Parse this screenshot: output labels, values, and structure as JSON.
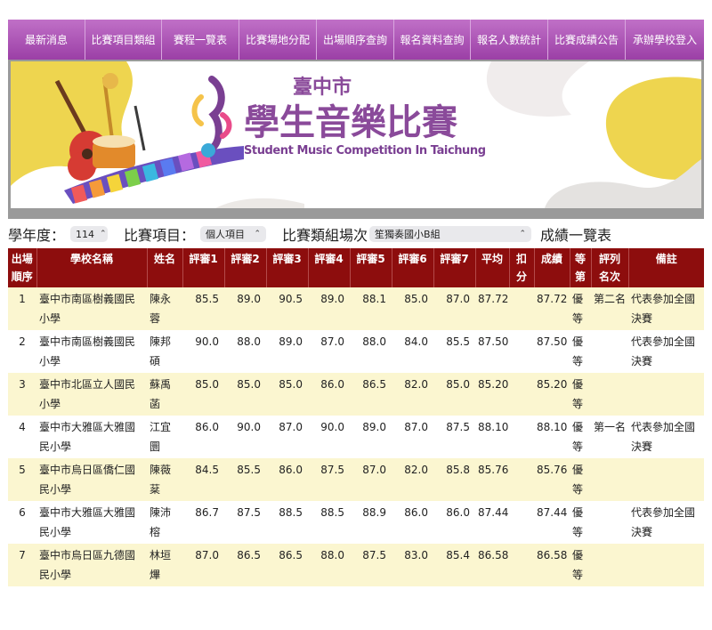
{
  "nav": [
    {
      "label": "最新消息"
    },
    {
      "label": "比賽項目類組"
    },
    {
      "label": "賽程一覽表"
    },
    {
      "label": "比賽場地分配"
    },
    {
      "label": "出場順序查詢"
    },
    {
      "label": "報名資料查詢"
    },
    {
      "label": "報名人數統計"
    },
    {
      "label": "比賽成績公告"
    },
    {
      "label": "承辦學校登入"
    }
  ],
  "banner": {
    "city": "臺中市",
    "title": "學生音樂比賽",
    "subtitle": "Student Music Competition In Taichung",
    "colors": {
      "yellow": "#eed54f",
      "purple": "#8a4a9a",
      "gray": "#e4e2e0"
    }
  },
  "filters": {
    "year_label": "學年度：",
    "year_value": "114",
    "item_label": "比賽項目：",
    "item_value": "個人項目",
    "group_label": "比賽類組場次",
    "group_value": "笙獨奏國小B組",
    "result_label": "成績一覽表"
  },
  "table": {
    "headers": [
      "出場順序",
      "學校名稱",
      "姓名",
      "評審1",
      "評審2",
      "評審3",
      "評審4",
      "評審5",
      "評審6",
      "評審7",
      "平均",
      "扣分",
      "成績",
      "等第",
      "評列名次",
      "備註"
    ],
    "rows": [
      [
        "1",
        "臺中市南區樹義國民小學",
        "陳永蓉",
        "85.5",
        "89.0",
        "90.5",
        "89.0",
        "88.1",
        "85.0",
        "87.0",
        "87.72",
        "",
        "87.72",
        "優等",
        "第二名",
        "代表參加全國決賽"
      ],
      [
        "2",
        "臺中市南區樹義國民小學",
        "陳邦碩",
        "90.0",
        "88.0",
        "89.0",
        "87.0",
        "88.0",
        "84.0",
        "85.5",
        "87.50",
        "",
        "87.50",
        "優等",
        "",
        "代表參加全國決賽"
      ],
      [
        "3",
        "臺中市北區立人國民小學",
        "蘇禹菡",
        "85.0",
        "85.0",
        "85.0",
        "86.0",
        "86.5",
        "82.0",
        "85.0",
        "85.20",
        "",
        "85.20",
        "優等",
        "",
        ""
      ],
      [
        "4",
        "臺中市大雅區大雅國民小學",
        "江宜圜",
        "86.0",
        "90.0",
        "87.0",
        "90.0",
        "89.0",
        "87.0",
        "87.5",
        "88.10",
        "",
        "88.10",
        "優等",
        "第一名",
        "代表參加全國決賽"
      ],
      [
        "5",
        "臺中市烏日區僑仁國民小學",
        "陳薇棻",
        "84.5",
        "85.5",
        "86.0",
        "87.5",
        "87.0",
        "82.0",
        "85.8",
        "85.76",
        "",
        "85.76",
        "優等",
        "",
        ""
      ],
      [
        "6",
        "臺中市大雅區大雅國民小學",
        "陳沛榕",
        "86.7",
        "87.5",
        "88.5",
        "88.5",
        "88.9",
        "86.0",
        "86.0",
        "87.44",
        "",
        "87.44",
        "優等",
        "",
        "代表參加全國決賽"
      ],
      [
        "7",
        "臺中市烏日區九德國民小學",
        "林垣熚",
        "87.0",
        "86.5",
        "86.5",
        "88.0",
        "87.5",
        "83.0",
        "85.4",
        "86.58",
        "",
        "86.58",
        "優等",
        "",
        ""
      ]
    ]
  }
}
